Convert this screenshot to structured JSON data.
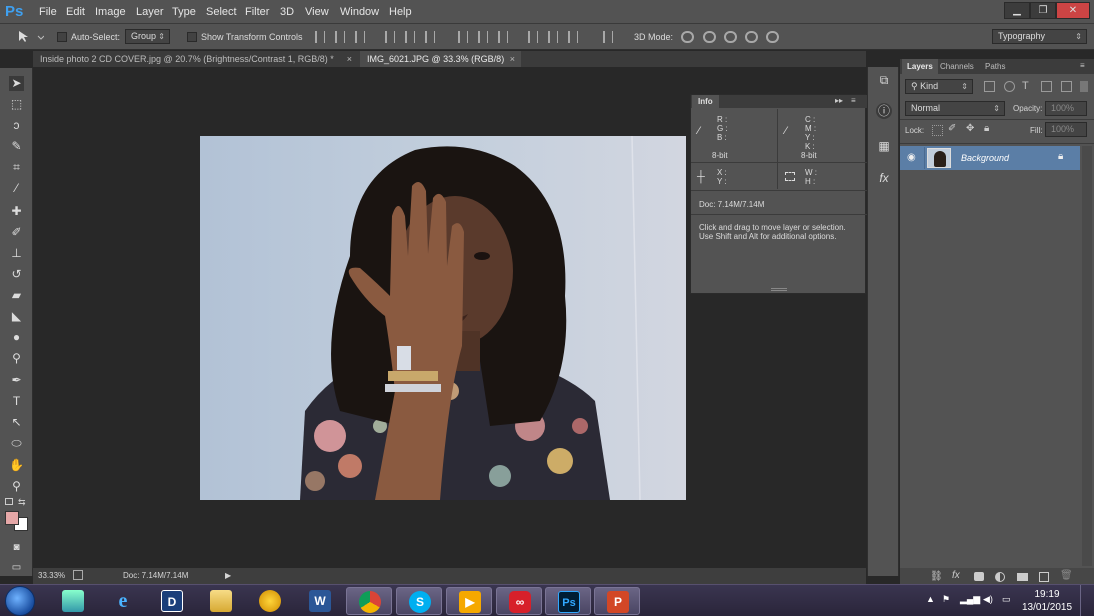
{
  "app": {
    "logo": "Ps"
  },
  "menu": [
    "File",
    "Edit",
    "Image",
    "Layer",
    "Type",
    "Select",
    "Filter",
    "3D",
    "View",
    "Window",
    "Help"
  ],
  "window_controls": {
    "minimize": "▁",
    "restore": "❐",
    "close": "✕"
  },
  "options": {
    "auto_select_label": "Auto-Select:",
    "auto_select_value": "Group",
    "show_transform_label": "Show Transform Controls",
    "mode_3d_label": "3D Mode:",
    "workspace": "Typography"
  },
  "tabs": [
    {
      "label": "Inside photo 2 CD COVER.jpg @ 20.7% (Brightness/Contrast 1, RGB/8) *",
      "active": false
    },
    {
      "label": "IMG_6021.JPG @ 33.3% (RGB/8)",
      "active": true
    }
  ],
  "tab_close": "×",
  "status": {
    "zoom": "33.33%",
    "doc": "Doc: 7.14M/7.14M",
    "arrow": "▶"
  },
  "info_panel": {
    "tab": "Info",
    "rgb": [
      "R :",
      "G :",
      "B :"
    ],
    "cmyk": [
      "C :",
      "M :",
      "Y :",
      "K :"
    ],
    "bit_left": "8-bit",
    "bit_right": "8-bit",
    "xy": [
      "X :",
      "Y :"
    ],
    "wh": [
      "W :",
      "H :"
    ],
    "doc": "Doc: 7.14M/7.14M",
    "hint_line1": "Click and drag to move layer or selection.",
    "hint_line2": "Use Shift and Alt for additional options."
  },
  "layers_panel": {
    "tabs": [
      "Layers",
      "Channels",
      "Paths"
    ],
    "filter_kind": "Kind",
    "blend_mode": "Normal",
    "opacity_label": "Opacity:",
    "opacity_value": "100%",
    "lock_label": "Lock:",
    "fill_label": "Fill:",
    "fill_value": "100%",
    "layer_name": "Background"
  },
  "taskbar": {
    "apps": [
      "photoshop-elements",
      "internet-explorer",
      "dolby",
      "file-explorer",
      "fl-studio",
      "word",
      "chrome",
      "skype",
      "media-player",
      "creative-cloud",
      "photoshop",
      "powerpoint"
    ],
    "app_labels": {
      "ie": "e",
      "dolby": "D",
      "word": "W",
      "skype": "S",
      "ps": "Ps",
      "ppt": "P"
    },
    "clock_time": "19:19",
    "clock_date": "13/01/2015"
  },
  "colors": {
    "chrome_bg": "#535353",
    "canvas_bg": "#282828",
    "accent": "#3fa0f0",
    "layer_selected": "#5b7ea6",
    "foreground_swatch": "#e6a8a8",
    "background_swatch": "#ffffff"
  }
}
